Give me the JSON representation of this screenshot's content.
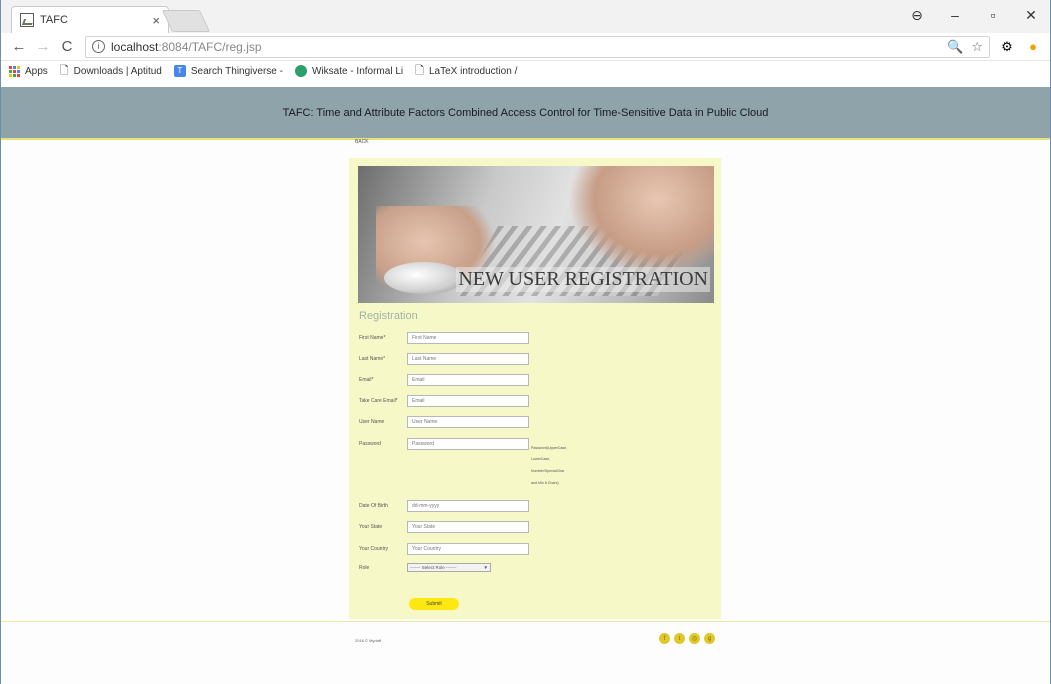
{
  "browser": {
    "tab_title": "TAFC",
    "tab_close": "×",
    "window_controls": [
      "⊖",
      "–",
      "▫",
      "✕"
    ],
    "url_host": "localhost",
    "url_rest": ":8084/TAFC/reg.jsp",
    "bookmarks": [
      {
        "label": "Apps",
        "icon": "apps-grid-icon"
      },
      {
        "label": "Downloads | Aptitud",
        "icon": "page-icon"
      },
      {
        "label": "Search Thingiverse -",
        "icon": "thingiverse-icon"
      },
      {
        "label": "Wiksate - Informal Li",
        "icon": "wiksate-icon"
      },
      {
        "label": "LaTeX introduction /",
        "icon": "page-icon"
      }
    ]
  },
  "page": {
    "header_title": "TAFC: Time and Attribute Factors Combined Access Control for Time-Sensitive Data in Public Cloud",
    "back_link": "BACK",
    "banner_title": "NEW USER REGISTRATION",
    "form_title": "Registration",
    "fields": [
      {
        "label": "First Name*",
        "placeholder": "First Name"
      },
      {
        "label": "Last Name*",
        "placeholder": "Last Name"
      },
      {
        "label": "Email*",
        "placeholder": "Email"
      },
      {
        "label": "Take Care Email*",
        "placeholder": "Email"
      },
      {
        "label": "User Name",
        "placeholder": "User Name"
      },
      {
        "label": "Password",
        "placeholder": "Password"
      },
      {
        "label": "Date Of Birth",
        "placeholder": "dd-mm-yyyy"
      },
      {
        "label": "Your State",
        "placeholder": "Your State"
      },
      {
        "label": "Your Country",
        "placeholder": "Your Country"
      }
    ],
    "password_hints": [
      "Password(UpperCase,",
      "LowerCase,",
      "Number/SpecialChar",
      "and Min 8 Chars)"
    ],
    "role_label": "Role",
    "role_select": "------- Select Role -------",
    "submit_label": "Submit",
    "copyright": "2016 © Mydaff",
    "social_icons": [
      "facebook-icon",
      "twitter-icon",
      "dribbble-icon",
      "googleplus-icon"
    ]
  }
}
